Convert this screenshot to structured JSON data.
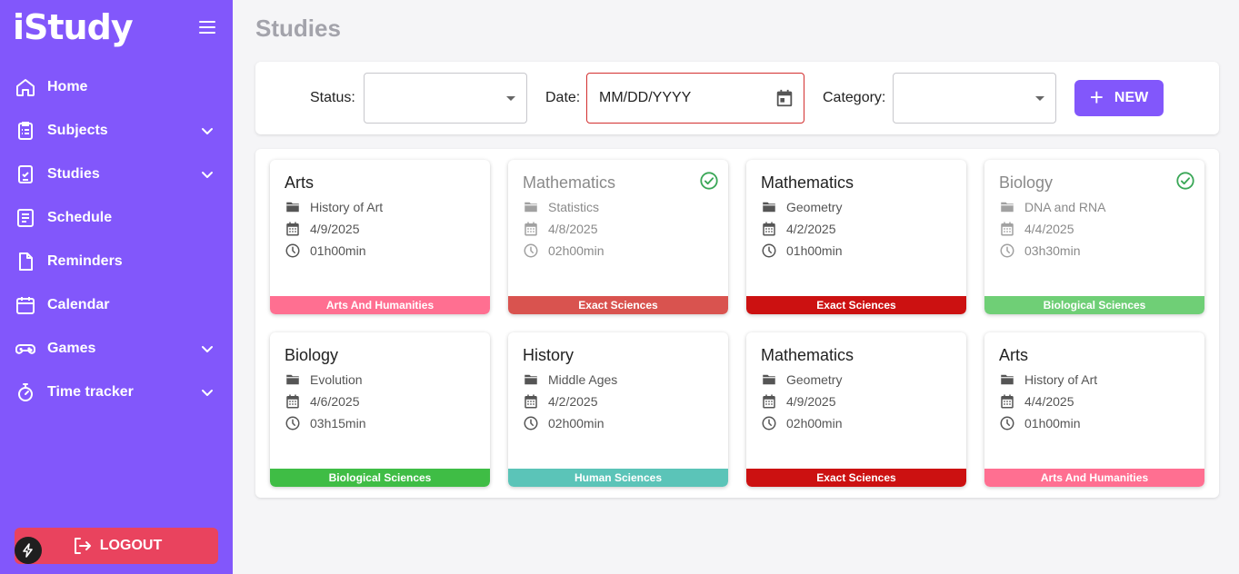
{
  "app": {
    "logo": "iStudy"
  },
  "sidebar": {
    "items": [
      {
        "label": "Home",
        "icon": "home-icon",
        "expandable": false
      },
      {
        "label": "Subjects",
        "icon": "clipboard-list-icon",
        "expandable": true
      },
      {
        "label": "Studies",
        "icon": "clipboard-check-icon",
        "expandable": true
      },
      {
        "label": "Schedule",
        "icon": "schedule-list-icon",
        "expandable": false
      },
      {
        "label": "Reminders",
        "icon": "document-icon",
        "expandable": false
      },
      {
        "label": "Calendar",
        "icon": "calendar-icon",
        "expandable": false
      },
      {
        "label": "Games",
        "icon": "gamepad-icon",
        "expandable": true
      },
      {
        "label": "Time tracker",
        "icon": "stopwatch-icon",
        "expandable": true
      }
    ],
    "logout_label": "LOGOUT"
  },
  "page": {
    "title": "Studies"
  },
  "filters": {
    "status_label": "Status:",
    "status_value": "",
    "date_label": "Date:",
    "date_placeholder": "MM/DD/YYYY",
    "category_label": "Category:",
    "category_value": "",
    "new_button": "NEW"
  },
  "colors": {
    "primary": "#8257fb",
    "logout": "#e9435e",
    "arts": "#ff6f91",
    "exact_light": "#d9534f",
    "exact_dark": "#cc1111",
    "bio_light": "#6fcf76",
    "bio_dark": "#3fbd45",
    "human": "#5bc4b8",
    "done_check": "#3aa757"
  },
  "cards": [
    {
      "subject": "Arts",
      "topic": "History of Art",
      "date": "4/9/2025",
      "duration": "01h00min",
      "category": "Arts And Humanities",
      "color": "#ff6f91",
      "done": false
    },
    {
      "subject": "Mathematics",
      "topic": "Statistics",
      "date": "4/8/2025",
      "duration": "02h00min",
      "category": "Exact Sciences",
      "color": "#d9534f",
      "done": true
    },
    {
      "subject": "Mathematics",
      "topic": "Geometry",
      "date": "4/2/2025",
      "duration": "01h00min",
      "category": "Exact Sciences",
      "color": "#cc1111",
      "done": false
    },
    {
      "subject": "Biology",
      "topic": "DNA and RNA",
      "date": "4/4/2025",
      "duration": "03h30min",
      "category": "Biological Sciences",
      "color": "#6fcf76",
      "done": true
    },
    {
      "subject": "Biology",
      "topic": "Evolution",
      "date": "4/6/2025",
      "duration": "03h15min",
      "category": "Biological Sciences",
      "color": "#3fbd45",
      "done": false
    },
    {
      "subject": "History",
      "topic": "Middle Ages",
      "date": "4/2/2025",
      "duration": "02h00min",
      "category": "Human Sciences",
      "color": "#5bc4b8",
      "done": false
    },
    {
      "subject": "Mathematics",
      "topic": "Geometry",
      "date": "4/9/2025",
      "duration": "02h00min",
      "category": "Exact Sciences",
      "color": "#cc1111",
      "done": false
    },
    {
      "subject": "Arts",
      "topic": "History of Art",
      "date": "4/4/2025",
      "duration": "01h00min",
      "category": "Arts And Humanities",
      "color": "#ff6f91",
      "done": false
    }
  ]
}
